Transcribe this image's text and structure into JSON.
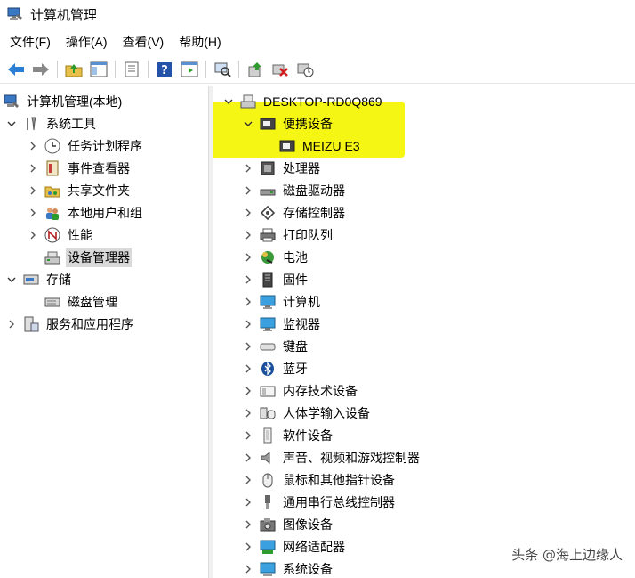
{
  "window": {
    "title": "计算机管理"
  },
  "menu": [
    "文件(F)",
    "操作(A)",
    "查看(V)",
    "帮助(H)"
  ],
  "toolbar": {
    "buttons": [
      "back-icon",
      "forward-icon",
      "up-folder-icon",
      "show-hide-tree-icon",
      "properties-icon",
      "help-icon",
      "show-action-pane-icon",
      "scan-hardware-icon",
      "update-driver-icon",
      "uninstall-device-icon",
      "disable-device-icon"
    ]
  },
  "left_tree": {
    "root": "计算机管理(本地)",
    "system_tools": "系统工具",
    "task_scheduler": "任务计划程序",
    "event_viewer": "事件查看器",
    "shared_folders": "共享文件夹",
    "local_users": "本地用户和组",
    "performance": "性能",
    "device_manager": "设备管理器",
    "storage": "存储",
    "disk_management": "磁盘管理",
    "services_apps": "服务和应用程序"
  },
  "right_tree": {
    "computer_name": "DESKTOP-RD0Q869",
    "portable": "便携设备",
    "portable_child": "MEIZU E3",
    "categories": [
      "处理器",
      "磁盘驱动器",
      "存储控制器",
      "打印队列",
      "电池",
      "固件",
      "计算机",
      "监视器",
      "键盘",
      "蓝牙",
      "内存技术设备",
      "人体学输入设备",
      "软件设备",
      "声音、视频和游戏控制器",
      "鼠标和其他指针设备",
      "通用串行总线控制器",
      "图像设备",
      "网络适配器",
      "系统设备"
    ]
  },
  "watermark": "头条 @海上边缘人",
  "colors": {
    "highlight": "#f5f500",
    "selection": "#d9d9d9"
  }
}
